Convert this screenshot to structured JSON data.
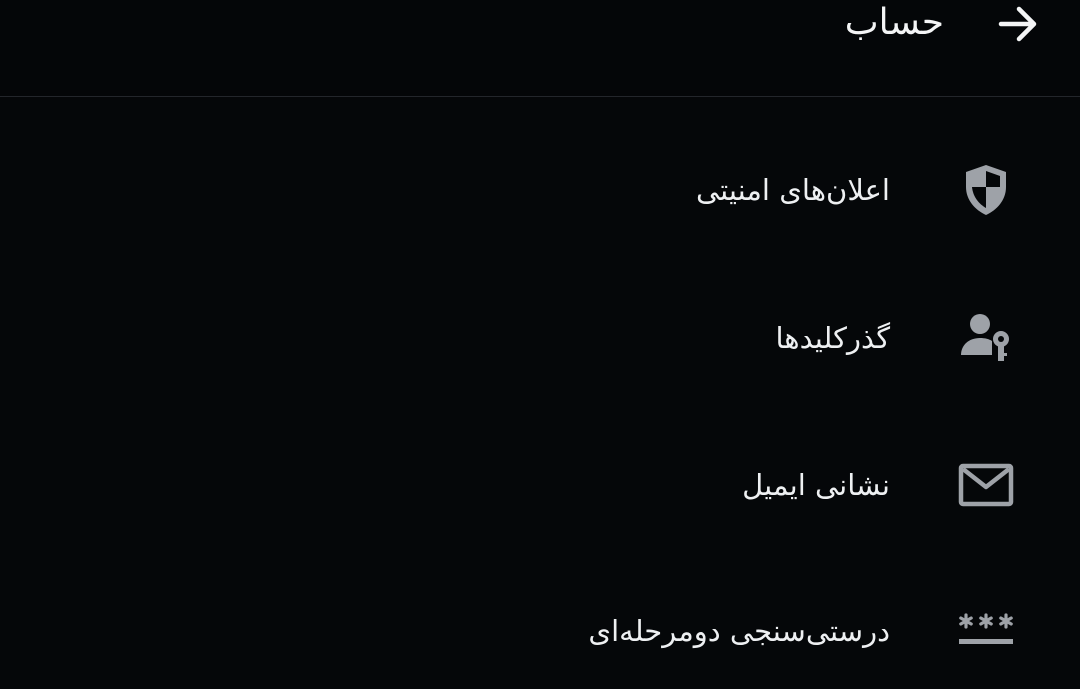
{
  "header": {
    "title": "حساب",
    "back_icon": "arrow-right-icon"
  },
  "menu": {
    "items": [
      {
        "label": "اعلان‌های امنیتی",
        "icon": "shield-icon"
      },
      {
        "label": "گذرکلیدها",
        "icon": "user-key-icon"
      },
      {
        "label": "نشانی ایمیل",
        "icon": "envelope-icon"
      },
      {
        "label": "درستی‌سنجی دومرحله‌ای",
        "icon": "password-asterisk-icon"
      }
    ]
  },
  "colors": {
    "background": "#050709",
    "text": "#eef0f2",
    "icon": "#9ea2a8",
    "divider": "#23262b"
  }
}
